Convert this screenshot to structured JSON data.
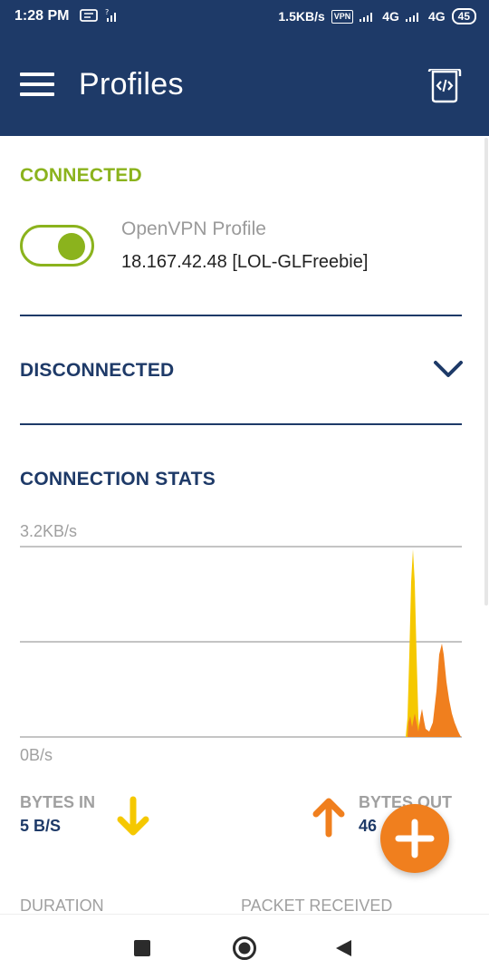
{
  "status_bar": {
    "time": "1:28 PM",
    "left_icons": [
      "message-icon",
      "signal-unknown-icon"
    ],
    "speed": "1.5KB/s",
    "vpn": "VPN",
    "network1": "4G",
    "network2": "4G",
    "battery": "45"
  },
  "app_bar": {
    "title": "Profiles",
    "menu_icon": "hamburger-menu-icon",
    "action_icon": "import-file-icon"
  },
  "connected": {
    "heading": "CONNECTED",
    "toggle_on": true,
    "profile_name": "OpenVPN Profile",
    "server": "18.167.42.48 [LOL-GLFreebie]"
  },
  "disconnected": {
    "heading": "DISCONNECTED",
    "expand_icon": "chevron-down-icon"
  },
  "stats": {
    "heading": "CONNECTION STATS",
    "axis_max": "3.2KB/s",
    "axis_min": "0B/s",
    "bytes_in_label": "BYTES IN",
    "bytes_in_value": "5 B/S",
    "bytes_out_label": "BYTES OUT",
    "bytes_out_value": "46",
    "duration_label": "DURATION",
    "packet_received_label": "PACKET RECEIVED"
  },
  "colors": {
    "primary": "#1e3a68",
    "connected": "#8bb31d",
    "bytes_in": "#f5c800",
    "bytes_out": "#f07f1e",
    "fab": "#f07f1e"
  },
  "fab": {
    "icon": "plus-icon"
  },
  "nav_bar": {
    "recent_icon": "recent-apps-icon",
    "home_icon": "home-icon",
    "back_icon": "back-icon"
  }
}
